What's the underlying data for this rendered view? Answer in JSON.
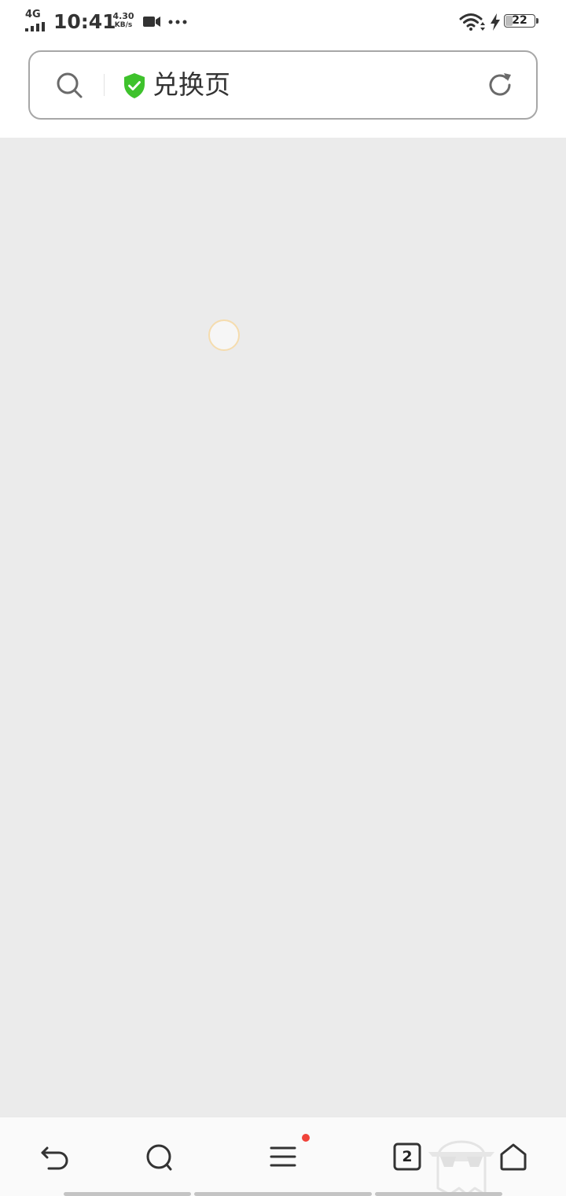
{
  "status_bar": {
    "network": "4G",
    "time": "10:41",
    "speed_value": "4.30",
    "speed_unit": "KB/s",
    "battery_level": "22",
    "icons": [
      "signal-icon",
      "video-icon",
      "more-dots-icon",
      "wifi-icon",
      "charging-icon",
      "battery-icon"
    ]
  },
  "address_bar": {
    "title": "兑换页",
    "icons": [
      "search-icon",
      "secure-shield-icon",
      "reload-icon"
    ],
    "shield_color": "#3ec22c"
  },
  "content": {
    "background": "#ebebeb",
    "loading": true
  },
  "bottom_nav": {
    "tab_count": "2",
    "menu_has_notification": true,
    "notification_color": "#f0433a",
    "icons": [
      "back-icon",
      "search-icon",
      "menu-icon",
      "tabs-icon",
      "ghost-mascot-icon",
      "home-icon"
    ]
  }
}
